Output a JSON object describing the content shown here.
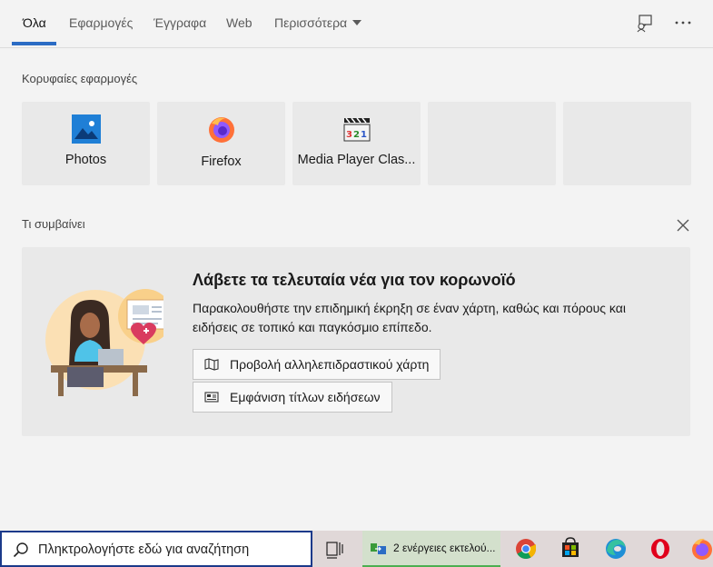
{
  "tabs": [
    {
      "label": "Όλα",
      "active": true
    },
    {
      "label": "Εφαρμογές"
    },
    {
      "label": "Έγγραφα"
    },
    {
      "label": "Web"
    },
    {
      "label": "Περισσότερα"
    }
  ],
  "header_icons": [
    "feedback-icon",
    "more-options-icon"
  ],
  "top_apps": {
    "title": "Κορυφαίες εφαρμογές",
    "items": [
      {
        "label": "Photos",
        "icon": "photos-icon"
      },
      {
        "label": "Firefox",
        "icon": "firefox-icon"
      },
      {
        "label": "Media Player Clas...",
        "icon": "media-player-classic-icon"
      }
    ]
  },
  "whats_new": {
    "title": "Τι συμβαίνει",
    "card": {
      "heading": "Λάβετε τα τελευταία νέα για τον κορωνοϊό",
      "description": "Παρακολουθήστε την επιδημική έκρηξη σε έναν χάρτη, καθώς και πόρους και ειδήσεις σε τοπικό και παγκόσμιο επίπεδο.",
      "button_map": "Προβολή αλληλεπιδραστικού χάρτη",
      "button_news": "Εμφάνιση τίτλων ειδήσεων"
    }
  },
  "taskbar": {
    "search_placeholder": "Πληκτρολογήστε εδώ για αναζήτηση",
    "task_label": "2 ενέργειες εκτελού...",
    "pinned": [
      "task-view-icon",
      "chrome-icon",
      "store-icon",
      "edge-icon",
      "opera-icon",
      "firefox-icon"
    ]
  },
  "colors": {
    "accent": "#2b6cc4",
    "search_border": "#1b3a8a"
  }
}
